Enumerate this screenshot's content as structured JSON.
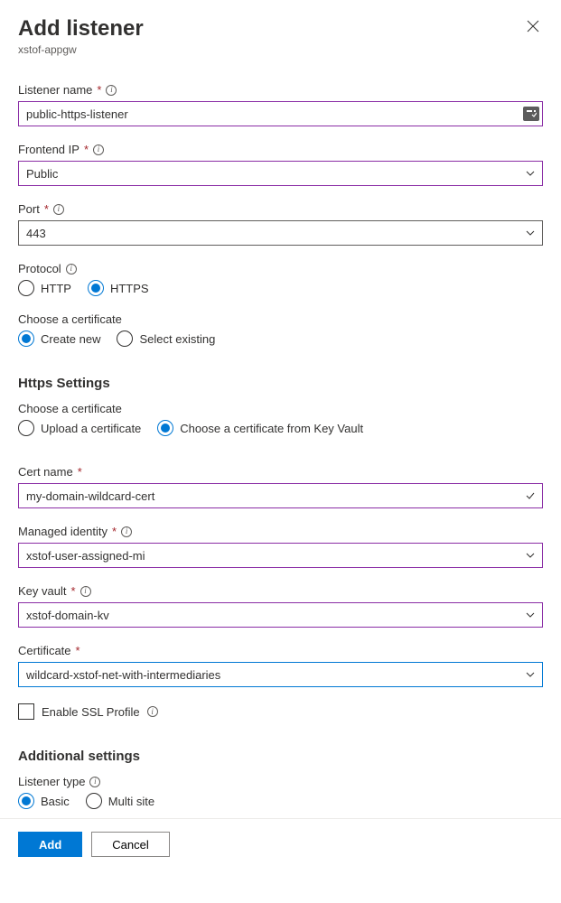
{
  "header": {
    "title": "Add listener",
    "subtitle": "xstof-appgw"
  },
  "fields": {
    "listenerName": {
      "label": "Listener name",
      "value": "public-https-listener"
    },
    "frontendIp": {
      "label": "Frontend IP",
      "value": "Public"
    },
    "port": {
      "label": "Port",
      "value": "443"
    },
    "protocol": {
      "label": "Protocol",
      "options": {
        "http": "HTTP",
        "https": "HTTPS"
      }
    },
    "chooseCert1": {
      "label": "Choose a certificate",
      "options": {
        "create": "Create new",
        "existing": "Select existing"
      }
    },
    "httpsSettings": "Https Settings",
    "chooseCert2": {
      "label": "Choose a certificate",
      "options": {
        "upload": "Upload a certificate",
        "keyvault": "Choose a certificate from Key Vault"
      }
    },
    "certName": {
      "label": "Cert name",
      "value": "my-domain-wildcard-cert"
    },
    "managedIdentity": {
      "label": "Managed identity",
      "value": "xstof-user-assigned-mi"
    },
    "keyVault": {
      "label": "Key vault",
      "value": "xstof-domain-kv"
    },
    "certificate": {
      "label": "Certificate",
      "value": "wildcard-xstof-net-with-intermediaries"
    },
    "enableSsl": {
      "label": "Enable SSL Profile"
    },
    "additionalSettings": "Additional settings",
    "listenerType": {
      "label": "Listener type",
      "options": {
        "basic": "Basic",
        "multi": "Multi site"
      }
    }
  },
  "footer": {
    "add": "Add",
    "cancel": "Cancel"
  }
}
